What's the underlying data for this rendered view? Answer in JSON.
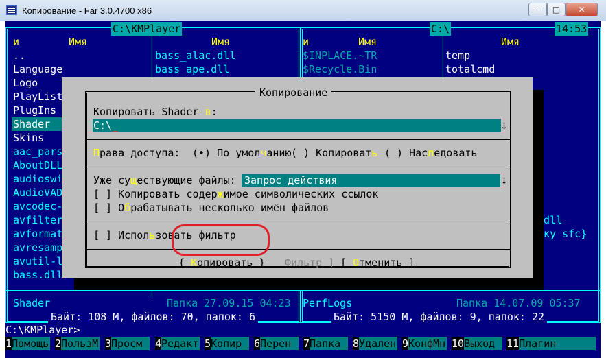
{
  "window": {
    "title": "Копирование - Far 3.0.4700 x86",
    "min_label": "–",
    "max_label": "□",
    "close_label": "✕"
  },
  "left_panel": {
    "path": "C:\\KMPlayer",
    "col_n": "и",
    "col_name1": "Имя",
    "col_name2": "Имя",
    "files_col1": [
      "..",
      "Language",
      "Logo",
      "PlayList",
      "PlugIns",
      "Shader",
      "Skins",
      "aac_pars",
      "AboutDLL",
      "audioswi",
      "AudioVAD",
      "avcodec-",
      "avfilter",
      "avformat",
      "avresamp",
      "avutil-l",
      "bass.dll"
    ],
    "files_col2": [
      "bass_alac.dll",
      "bass_ape.dll"
    ],
    "status_name": "Shader",
    "status_info": "Папка 27.09.15 04:23",
    "summary": "Байт: 108 M, файлов: 70, папок: 6"
  },
  "right_panel": {
    "path": "C:\\",
    "clock": "14:53",
    "col_n": "и",
    "col_name1": "Имя",
    "col_name2": "Имя",
    "files_col1": [
      "$INPLACE.~TR",
      "$Recycle.Bin"
    ],
    "files_col2": [
      "temp",
      "totalcmd"
    ],
    "partial_1": "r.dll",
    "partial_2": "ерку sfc}",
    "status_name": "PerfLogs",
    "status_info": "Папка 14.07.09 05:37",
    "summary": "Байт: 5150 M, файлов: 9, папок: 22"
  },
  "dialog": {
    "title": "Копирование",
    "copy_to_label_a": "Копировать Shader ",
    "copy_to_label_hot": "в",
    "copy_to_label_b": ":",
    "target_value": "C:\\",
    "access_a": "П",
    "access_b": "рава доступа: ",
    "radio_default": "(•) По умол",
    "radio_default_hot": "ч",
    "radio_default_b": "анию",
    "radio_copy": "( ) Копироват",
    "radio_copy_hot": "ь",
    "radio_inherit": "( ) Нас",
    "radio_inherit_hot": "л",
    "radio_inherit_b": "едовать",
    "existing_a": "Уже су",
    "existing_hot": "щ",
    "existing_b": "ествующие файлы:",
    "existing_value": "Запрос действия",
    "cb_symlinks_a": "[ ] Копировать содер",
    "cb_symlinks_hot": "ж",
    "cb_symlinks_b": "имое символических ссылок",
    "cb_multi_a": "[ ] О",
    "cb_multi_hot": "б",
    "cb_multi_b": "рабатывать несколько имён файлов",
    "cb_filter_a": "[ ] Испол",
    "cb_filter_hot": "ь",
    "cb_filter_b": "зовать фильтр",
    "btn_copy_open": "{ ",
    "btn_copy_hot": "К",
    "btn_copy_rest": "опировать }",
    "btn_filter": "Фильтр ]",
    "btn_cancel_open": "[ ",
    "btn_cancel_hot": "О",
    "btn_cancel_rest": "тменить ]",
    "scroll_arrow": "↓"
  },
  "command_line": "C:\\KMPlayer>",
  "fkeys": [
    {
      "n": "1",
      "label": "Помощь"
    },
    {
      "n": "2",
      "label": "ПользМ"
    },
    {
      "n": "3",
      "label": "Просм"
    },
    {
      "n": "4",
      "label": "Редакт"
    },
    {
      "n": "5",
      "label": "Копир"
    },
    {
      "n": "6",
      "label": "Перен"
    },
    {
      "n": "7",
      "label": "Папка"
    },
    {
      "n": "8",
      "label": "Удален"
    },
    {
      "n": "9",
      "label": "КонфМн"
    },
    {
      "n": "10",
      "label": "Выход"
    },
    {
      "n": "11",
      "label": "Плагин"
    }
  ],
  "colors": {
    "console_bg": "#000080",
    "frame": "#00ffff",
    "dialog_bg": "#c0c0c0",
    "highlight": "#008080",
    "accent_ring": "#e0202a"
  }
}
